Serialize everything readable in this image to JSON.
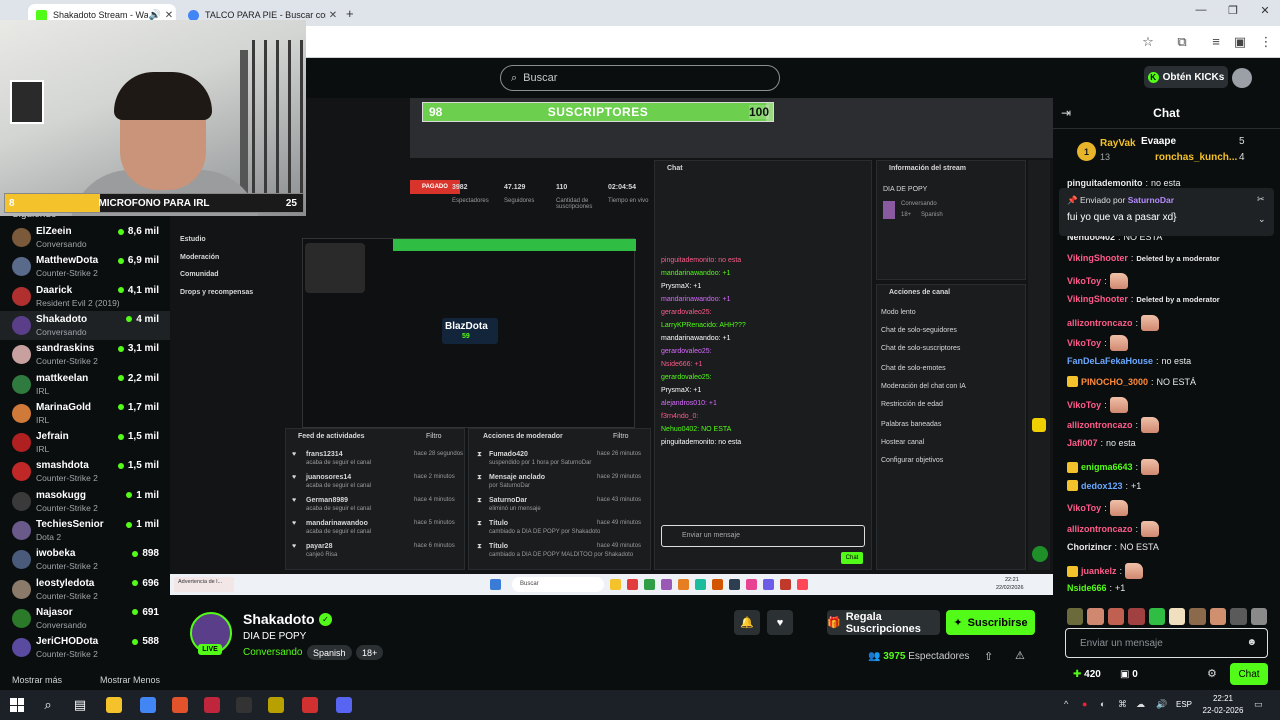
{
  "browser": {
    "tabs": [
      {
        "title": "Shakadoto Stream - Watch",
        "active": true
      },
      {
        "title": "TALCO PARA PIE - Buscar con G",
        "active": false
      }
    ],
    "new_tab": "+",
    "window_controls": [
      "—",
      "❐",
      "✕"
    ]
  },
  "header": {
    "search_placeholder": "Buscar",
    "get_kicks_label": "Obtén KICKs"
  },
  "overlays": {
    "mic_goal": {
      "current": "8",
      "label": "MICROFONO PARA IRL",
      "target": "25",
      "progress": 0.32
    },
    "sub_goal": {
      "current": "98",
      "label": "SUSCRIPTORES",
      "target": "100",
      "progress": 0.98
    }
  },
  "sidebar": {
    "title": "Siguiendo",
    "channels": [
      {
        "name": "ElZeein",
        "category": "Conversando",
        "viewers": "8,6 mil",
        "color": "#7a5a3a"
      },
      {
        "name": "MatthewDota",
        "category": "Counter-Strike 2",
        "viewers": "6,9 mil",
        "color": "#5a6a8a"
      },
      {
        "name": "Daarick",
        "category": "Resident Evil 2 (2019)",
        "viewers": "4,1 mil",
        "color": "#b03030"
      },
      {
        "name": "Shakadoto",
        "category": "Conversando",
        "viewers": "4 mil",
        "color": "#5a3e8a"
      },
      {
        "name": "sandraskins",
        "category": "Counter-Strike 2",
        "viewers": "3,1 mil",
        "color": "#c9a0a0"
      },
      {
        "name": "mattkeelan",
        "category": "IRL",
        "viewers": "2,2 mil",
        "color": "#2f7a3f"
      },
      {
        "name": "MarinaGold",
        "category": "IRL",
        "viewers": "1,7 mil",
        "color": "#d07a3a"
      },
      {
        "name": "Jefrain",
        "category": "IRL",
        "viewers": "1,5 mil",
        "color": "#b02020"
      },
      {
        "name": "smashdota",
        "category": "Counter-Strike 2",
        "viewers": "1,5 mil",
        "color": "#c02828"
      },
      {
        "name": "masokugg",
        "category": "Counter-Strike 2",
        "viewers": "1 mil",
        "color": "#3a3a3a"
      },
      {
        "name": "TechiesSenior",
        "category": "Dota 2",
        "viewers": "1 mil",
        "color": "#6a5a8a"
      },
      {
        "name": "iwobeka",
        "category": "Counter-Strike 2",
        "viewers": "898",
        "color": "#4a5a7a"
      },
      {
        "name": "leostyledota",
        "category": "Counter-Strike 2",
        "viewers": "696",
        "color": "#8a7a6a"
      },
      {
        "name": "Najasor",
        "category": "Conversando",
        "viewers": "691",
        "color": "#2a7a2a"
      },
      {
        "name": "JeriCHODota",
        "category": "Counter-Strike 2",
        "viewers": "588",
        "color": "#5a4aa0"
      }
    ],
    "show_more": "Mostrar más",
    "show_less": "Mostrar Menos"
  },
  "video_screen": {
    "stats": [
      {
        "value": "3982",
        "label": "Espectadores"
      },
      {
        "value": "47.129",
        "label": "Seguidores"
      },
      {
        "value": "110",
        "label": "Cantidad de suscripciones"
      },
      {
        "value": "02:04:54",
        "label": "Tiempo en vivo"
      }
    ],
    "menu": [
      "Estudio",
      "Moderación",
      "Comunidad",
      "Drops y recompensas"
    ],
    "stream_info_title": "Información del stream",
    "stream_info_name": "DIA DE POPY",
    "stream_info_cat": "Conversando",
    "stream_info_tags": [
      "18+",
      "Spanish"
    ],
    "channel_actions_title": "Acciones de canal",
    "channel_actions": [
      "Modo lento",
      "Chat de solo-seguidores",
      "Chat de solo-suscriptores",
      "Chat de solo-emotes",
      "Moderación del chat con IA",
      "Restricción de edad",
      "Palabras baneadas",
      "Hostear canal",
      "Configurar objetivos"
    ],
    "activity_title": "Feed de actividades",
    "activity_filter": "Filtro",
    "activity": [
      {
        "user": "frans12314",
        "action": "acaba de seguir el canal",
        "time": "hace 28 segundos"
      },
      {
        "user": "juanosores14",
        "action": "acaba de seguir el canal",
        "time": "hace 2 minutos"
      },
      {
        "user": "German8989",
        "action": "acaba de seguir el canal",
        "time": "hace 4 minutos"
      },
      {
        "user": "mandarinawandoo",
        "action": "acaba de seguir el canal",
        "time": "hace 5 minutos"
      },
      {
        "user": "payar28",
        "action": "canjeó Risa",
        "time": "hace 6 minutos"
      }
    ],
    "mod_title": "Acciones de moderador",
    "mod_filter": "Filtro",
    "mod_actions": [
      {
        "title": "Fumado420",
        "detail": "suspendido por 1 hora por SaturnoDar",
        "time": "hace 26 minutos"
      },
      {
        "title": "Mensaje anclado",
        "detail": "por SaturnoDar",
        "time": "hace 29 minutos"
      },
      {
        "title": "SaturnoDar",
        "detail": "eliminó un mensaje",
        "time": "hace 43 minutos"
      },
      {
        "title": "Título",
        "detail": "cambiado a DIA DE POPY por Shakadoto",
        "time": "hace 49 minutos"
      },
      {
        "title": "Título",
        "detail": "cambiado a DIA DE POPY MALDITOO por Shakadoto",
        "time": "hace 49 minutos"
      }
    ],
    "mini_chat_title": "Chat",
    "mini_chat_lines": [
      "pinguitademonito: no esta",
      "mandarinawandoo: +1",
      "PrysmaX: +1",
      "mandarinawandoo: +1",
      "gerardovaleo25:",
      "LarryKPRenacido: AHH???",
      "mandarinawandoo: +1",
      "gerardovaleo25:",
      "Nside666: +1",
      "gerardovaleo25:",
      "PrysmaX: +1",
      "alejandros010: +1",
      "f3rn4ndo_0:",
      "Nehuo0402: NO ESTA",
      "pinguitademonito: no esta"
    ],
    "mini_chat_input": "Enviar un mensaje",
    "mini_chat_send": "Chat",
    "nested_name": "BlazDota",
    "nested_count": "59",
    "taskbar_search": "Buscar",
    "taskbar_clock": "22:21",
    "taskbar_date": "22/02/2026",
    "notice": "Advertencia de l..."
  },
  "stream": {
    "channel": "Shakadoto",
    "title": "DIA DE POPY",
    "category": "Conversando",
    "tags": [
      "Spanish",
      "18+"
    ],
    "live_label": "LIVE",
    "gift_label": "Regala Suscripciones",
    "subscribe_label": "Suscribirse",
    "viewer_count": "3975",
    "viewer_label": "Espectadores"
  },
  "chat": {
    "title": "Chat",
    "leaderboard": [
      {
        "rank": "1",
        "name": "RayVak",
        "value": "13"
      },
      {
        "name": "Evaape",
        "value": "5"
      },
      {
        "name": "ronchas_kunch...",
        "value": "4"
      }
    ],
    "pinned": {
      "by_label": "Enviado por",
      "by_user": "SaturnoDar",
      "message": "fui yo que va a pasar xd}"
    },
    "messages": [
      {
        "user": "pinguitademonito",
        "text": "no esta",
        "color": "#e9e9e9"
      },
      {
        "user": "Nehuo0402",
        "text": "NO ESTA",
        "color": "#e9e9e9"
      },
      {
        "user": "VikingShooter",
        "text": "Deleted by a moderator",
        "color": "#ff5b8a",
        "deleted": true
      },
      {
        "user": "VikoToy",
        "text": "",
        "color": "#ff5b8a",
        "emote": true
      },
      {
        "user": "VikingShooter",
        "text": "Deleted by a moderator",
        "color": "#ff5b8a",
        "deleted": true
      },
      {
        "user": "allizontroncazo",
        "text": "",
        "color": "#ff5b8a",
        "emote": true
      },
      {
        "user": "VikoToy",
        "text": "",
        "color": "#ff5b8a",
        "emote": true
      },
      {
        "user": "FanDeLaFekaHouse",
        "text": "no esta",
        "color": "#6aa8ff"
      },
      {
        "user": "PINOCHO_3000",
        "text": "NO ESTÁ",
        "color": "#ff8a3c",
        "badge": true
      },
      {
        "user": "VikoToy",
        "text": "",
        "color": "#ff5b8a",
        "emote": true
      },
      {
        "user": "allizontroncazo",
        "text": "",
        "color": "#ff5b8a",
        "emote": true
      },
      {
        "user": "Jafi007",
        "text": "no esta",
        "color": "#ff5b8a"
      },
      {
        "user": "enigma6643",
        "text": "",
        "color": "#53fc18",
        "emote": true,
        "badge": true
      },
      {
        "user": "dedox123",
        "text": "+1",
        "color": "#6aa8ff",
        "badge": true
      },
      {
        "user": "VikoToy",
        "text": "",
        "color": "#ff5b8a",
        "emote": true
      },
      {
        "user": "allizontroncazo",
        "text": "",
        "color": "#ff5b8a",
        "emote": true
      },
      {
        "user": "Chorizincr",
        "text": "NO ESTA",
        "color": "#e9e9e9"
      },
      {
        "user": "juankelz",
        "text": "",
        "color": "#ff5b8a",
        "emote": true,
        "badge": true
      },
      {
        "user": "Nside666",
        "text": "+1",
        "color": "#53fc18"
      }
    ],
    "input_placeholder": "Enviar un mensaje",
    "kicks_count": "420",
    "gift_count": "0",
    "send_label": "Chat"
  },
  "taskbar": {
    "language": "ESP",
    "time": "22:21",
    "date": "22-02-2026"
  }
}
